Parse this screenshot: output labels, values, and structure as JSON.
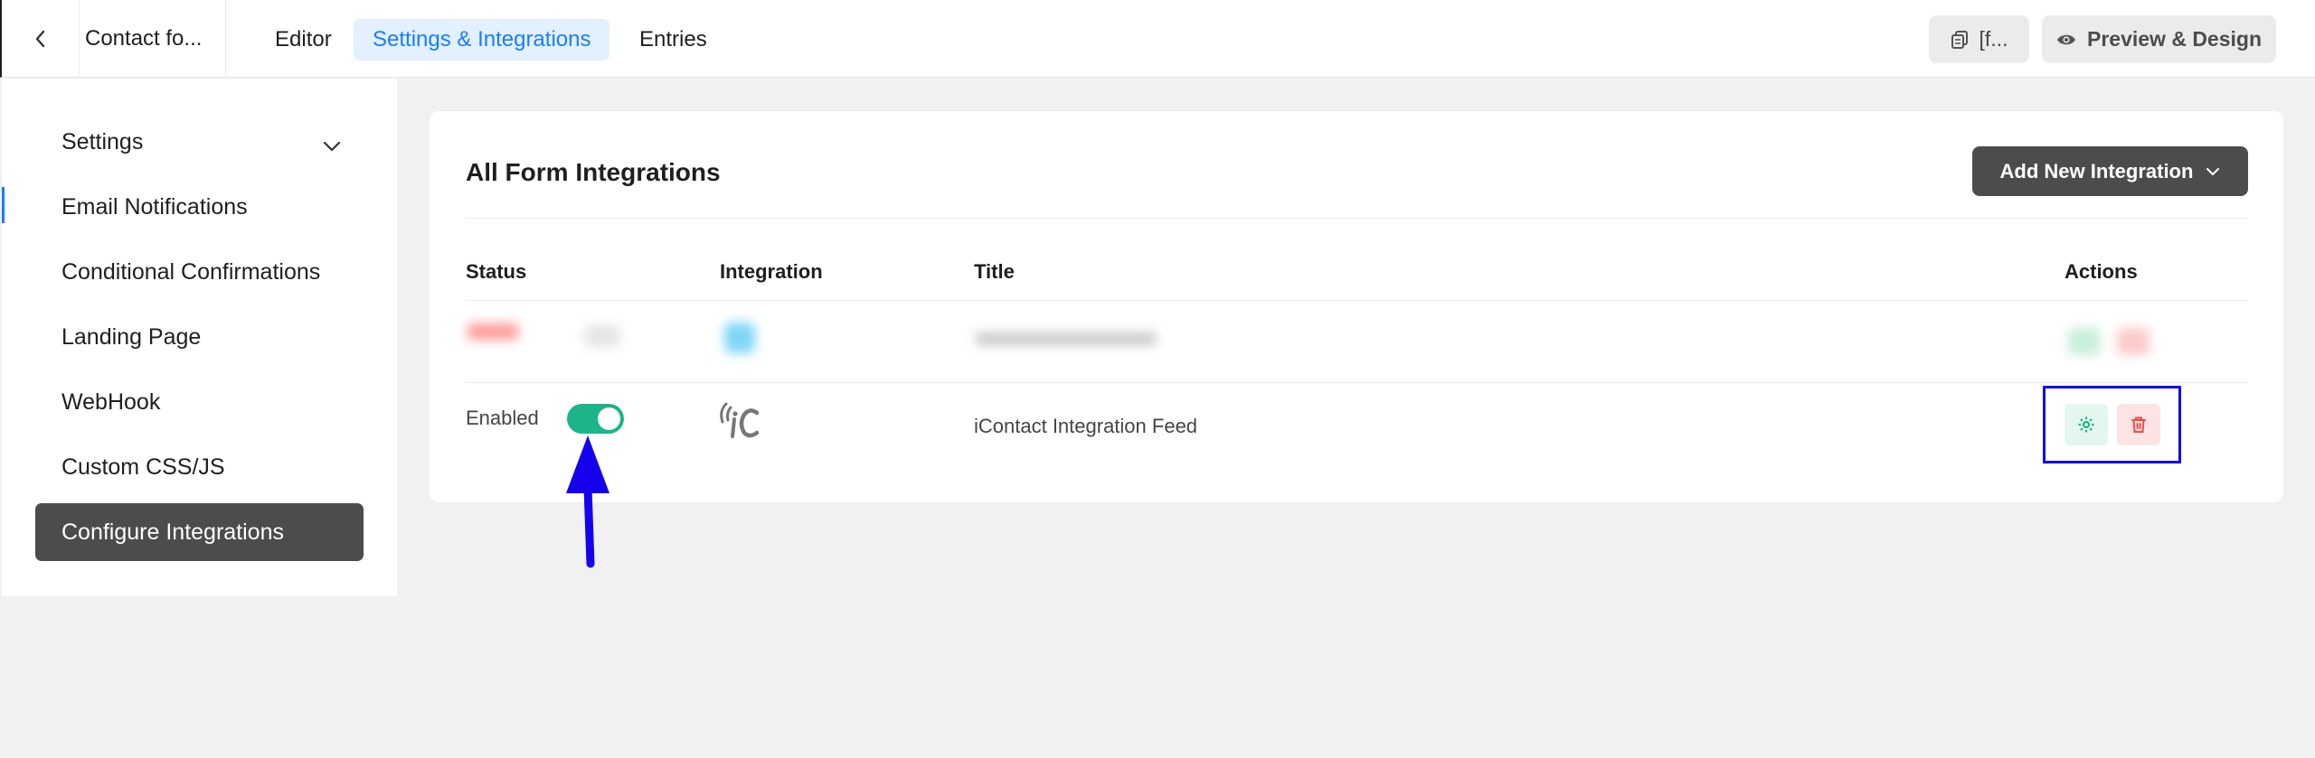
{
  "topbar": {
    "form_title": "Contact fo...",
    "tabs": [
      {
        "label": "Editor",
        "active": false
      },
      {
        "label": "Settings & Integrations",
        "active": true
      },
      {
        "label": "Entries",
        "active": false
      }
    ],
    "shortcode_label": "[f...",
    "preview_label": "Preview & Design"
  },
  "sidebar": {
    "items": [
      {
        "label": "Settings",
        "has_chevron": true
      },
      {
        "label": "Email Notifications"
      },
      {
        "label": "Conditional Confirmations"
      },
      {
        "label": "Landing Page"
      },
      {
        "label": "WebHook"
      },
      {
        "label": "Custom CSS/JS"
      },
      {
        "label": "Configure Integrations",
        "active": true
      }
    ]
  },
  "main": {
    "title": "All Form Integrations",
    "add_button_label": "Add New Integration",
    "columns": {
      "status": "Status",
      "integration": "Integration",
      "title": "Title",
      "actions": "Actions"
    },
    "rows": [
      {
        "status": "Enabled",
        "enabled": true,
        "integration_icon": "icontact-logo-icon",
        "title": "iContact Integration Feed"
      }
    ]
  },
  "colors": {
    "accent": "#1a7efb",
    "toggle_on": "#1db48a",
    "dark_button": "#4b4c4d",
    "annotation": "#1500ee"
  }
}
